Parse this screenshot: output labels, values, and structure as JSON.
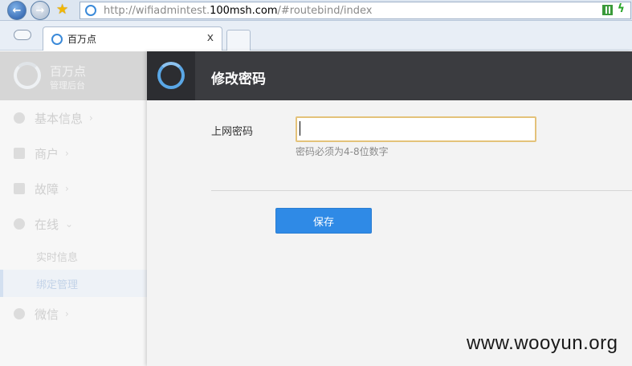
{
  "browser": {
    "url_prefix": "http://wifiadmintest.",
    "url_host": "100msh.com",
    "url_suffix": "/#routebind/index",
    "tab_title": "百万点",
    "tab_close": "x"
  },
  "sidebar": {
    "brand_title": "百万点",
    "brand_subtitle": "管理后台",
    "items": [
      {
        "label": "基本信息",
        "icon": "info-icon",
        "chevron": "›"
      },
      {
        "label": "商户",
        "icon": "store-icon",
        "chevron": "›"
      },
      {
        "label": "故障",
        "icon": "tools-icon",
        "chevron": "›"
      },
      {
        "label": "在线",
        "icon": "link-icon",
        "chevron": "⌄"
      },
      {
        "label": "微信",
        "icon": "wechat-icon",
        "chevron": "›"
      }
    ],
    "sub_items": [
      {
        "label": "实时信息",
        "active": false
      },
      {
        "label": "绑定管理",
        "active": true
      }
    ]
  },
  "modal": {
    "title": "修改密码",
    "field_label": "上网密码",
    "field_value": "",
    "hint": "密码必须为4-8位数字",
    "save_label": "保存"
  },
  "watermark": "www.wooyun.org",
  "colors": {
    "accent": "#2f8ae6",
    "header_dark": "#3b3c40",
    "input_focus": "#e4c27a"
  }
}
